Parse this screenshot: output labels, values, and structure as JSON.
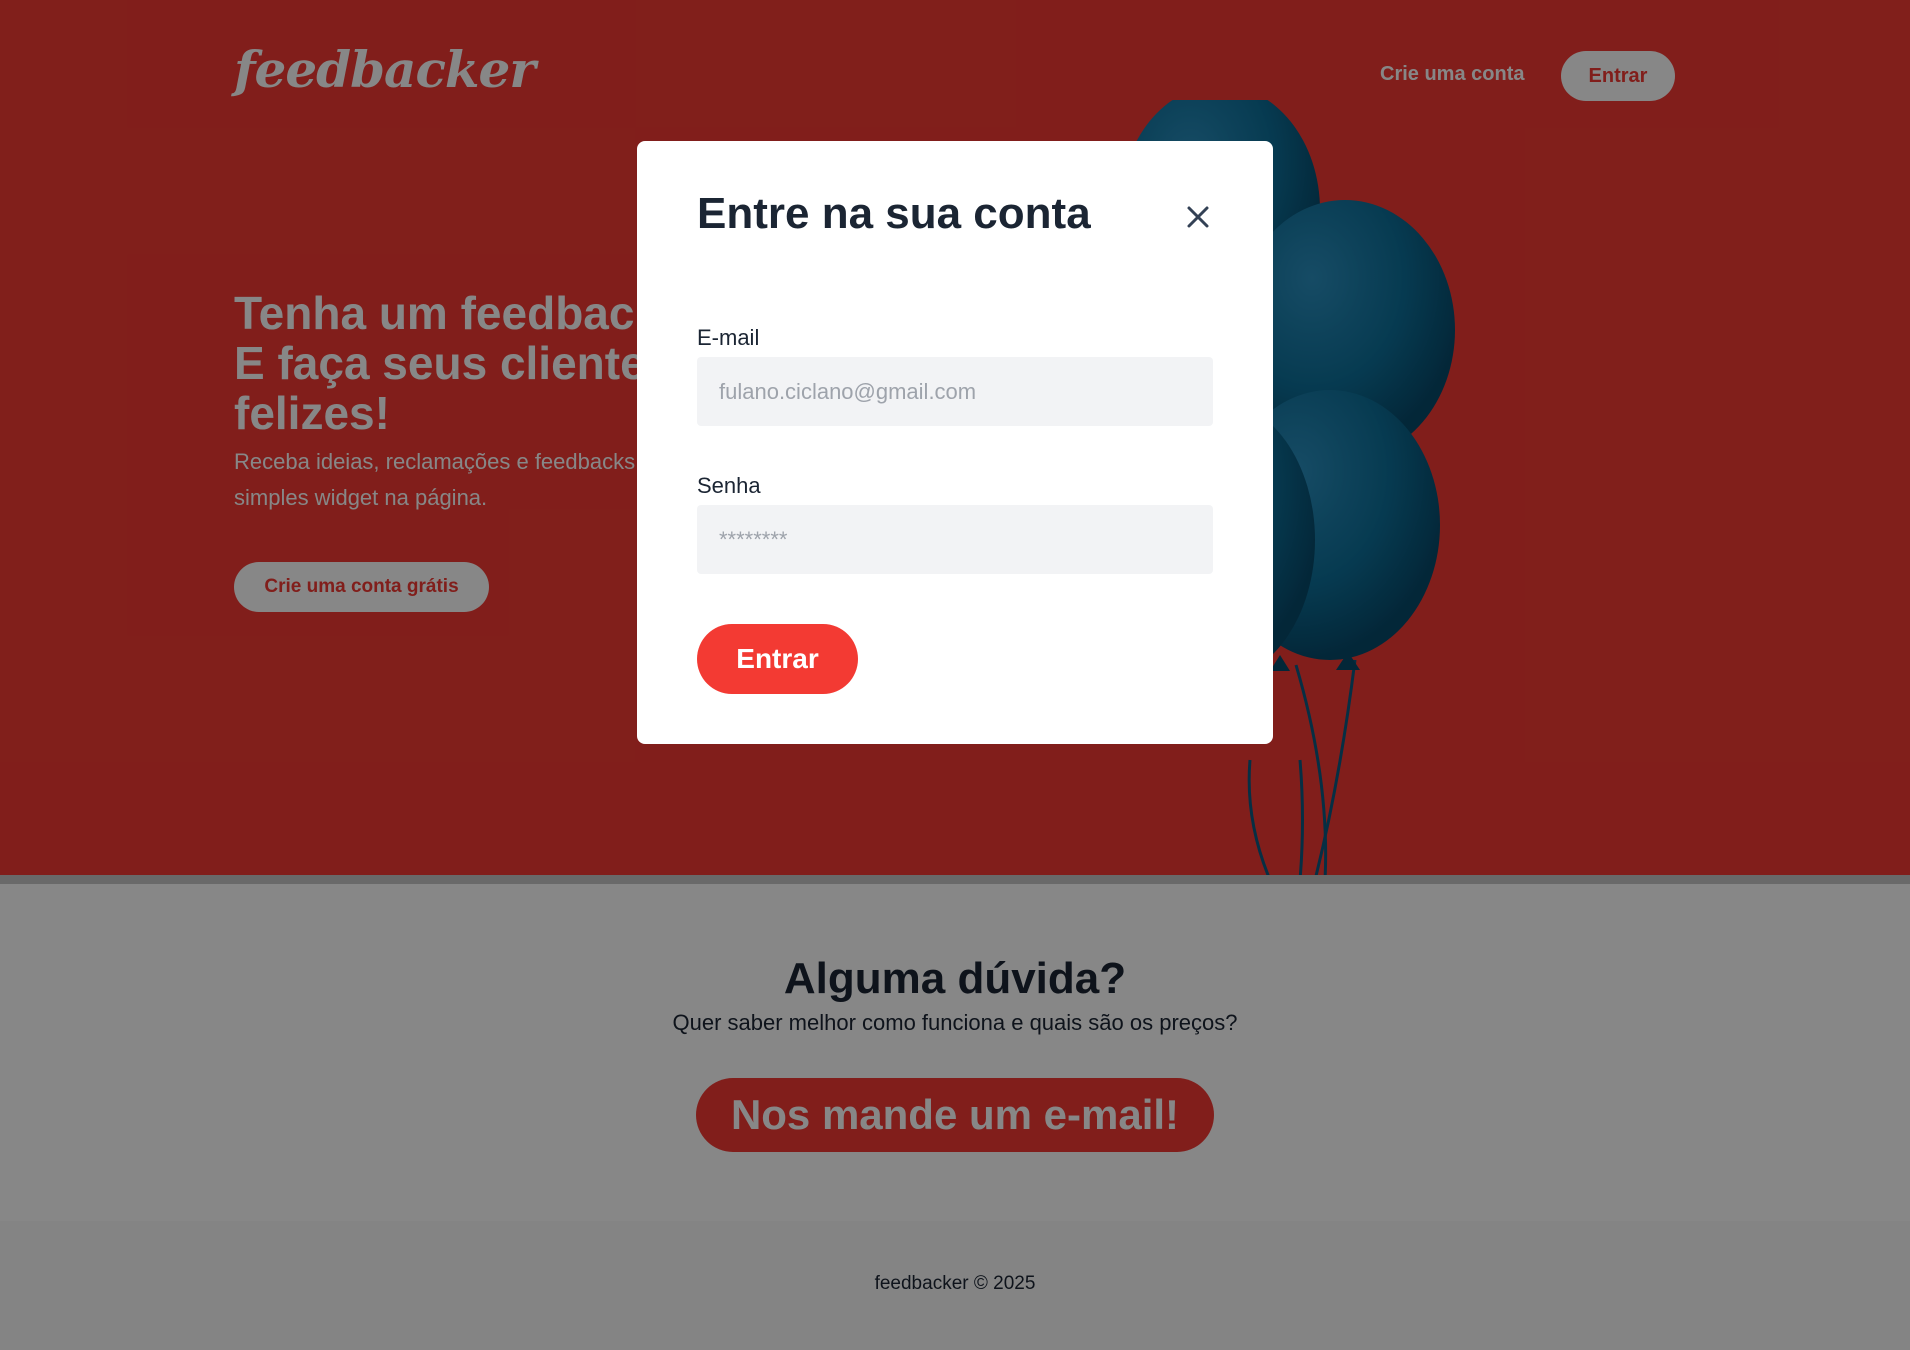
{
  "header": {
    "logo": "feedbacker",
    "create_account": "Crie uma conta",
    "login": "Entrar"
  },
  "hero": {
    "title_lines": [
      "Tenha um feedback",
      "E faça seus clientes",
      "felizes!"
    ],
    "subtitle_lines": [
      "Receba ideias, reclamações e feedbacks",
      "simples widget na página."
    ],
    "cta": "Crie uma conta grátis"
  },
  "modal": {
    "title": "Entre na sua conta",
    "email_label": "E-mail",
    "email_placeholder": "fulano.ciclano@gmail.com",
    "password_label": "Senha",
    "password_placeholder": "********",
    "submit": "Entrar"
  },
  "contact": {
    "title": "Alguma dúvida?",
    "subtitle": "Quer saber melhor como funciona e quais são os preços?",
    "button": "Nos mande um e-mail!"
  },
  "footer": {
    "text": "feedbacker © 2025"
  },
  "colors": {
    "brand": "#f33a33",
    "dark_text": "#1b2533",
    "input_bg": "#f2f3f5",
    "balloon": "#0d6f99"
  },
  "icons": {
    "close": "close-icon"
  }
}
